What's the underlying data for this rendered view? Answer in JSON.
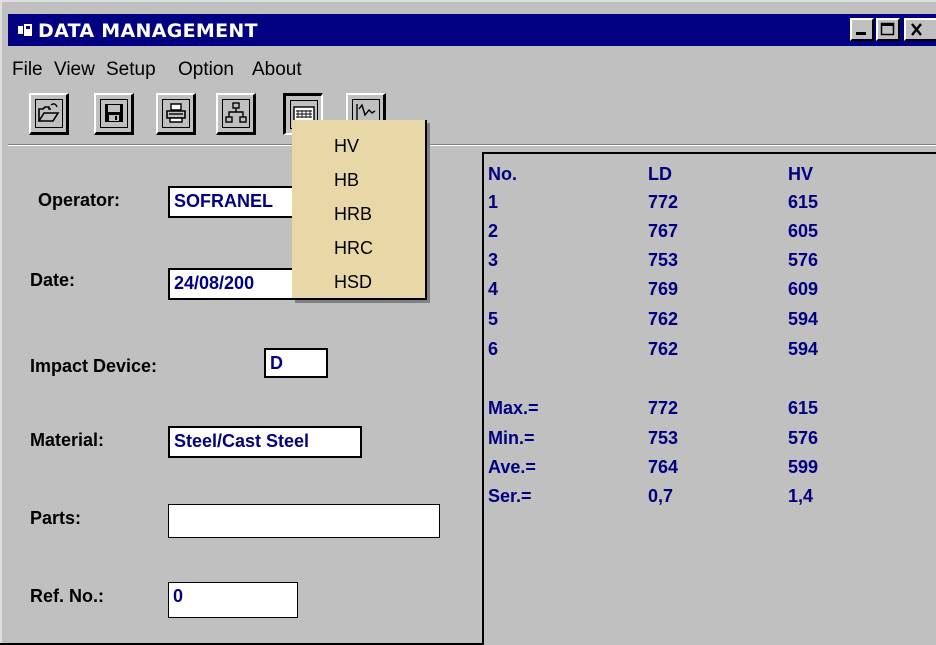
{
  "window": {
    "title": "DATA MANAGEMENT"
  },
  "menu": [
    "File",
    "View",
    "Setup",
    "Option",
    "About"
  ],
  "toolbar": {
    "tools": [
      "open-folder-icon",
      "save-disk-icon",
      "print-icon",
      "network-icon",
      "hardness-scale-icon",
      "curve-chart-icon"
    ]
  },
  "form": {
    "operator_label": "Operator:",
    "operator_value": "SOFRANEL",
    "date_label": "Date:",
    "date_value": "24/08/200",
    "impact_label": "Impact Device:",
    "impact_value": "D",
    "material_label": "Material:",
    "material_value": "Steel/Cast Steel",
    "parts_label": "Parts:",
    "parts_value": "",
    "ref_label": "Ref. No.:",
    "ref_value": "0"
  },
  "results": {
    "headers": [
      "No.",
      "LD",
      "HV"
    ],
    "rows": [
      [
        "1",
        "772",
        "615"
      ],
      [
        "2",
        "767",
        "605"
      ],
      [
        "3",
        "753",
        "576"
      ],
      [
        "4",
        "769",
        "609"
      ],
      [
        "5",
        "762",
        "594"
      ],
      [
        "6",
        "762",
        "594"
      ]
    ],
    "stats": [
      [
        "Max.=",
        "772",
        "615"
      ],
      [
        "Min.=",
        "753",
        "576"
      ],
      [
        "Ave.=",
        "764",
        "599"
      ],
      [
        "Ser.=",
        "0,7",
        "1,4"
      ]
    ]
  },
  "scale_menu": {
    "options": [
      "HV",
      "HB",
      "HRB",
      "HRC",
      "HSD"
    ]
  },
  "colors": {
    "title_bar": "#000080",
    "value_text": "#000080",
    "dropdown_bg": "#e8d8a8",
    "window_bg": "#c0c0c0"
  }
}
